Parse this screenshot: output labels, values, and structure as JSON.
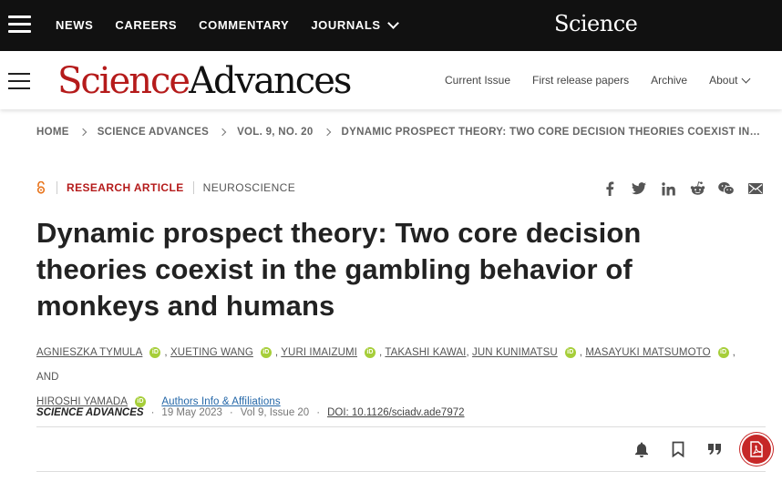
{
  "topnav": {
    "items": [
      {
        "label": "NEWS"
      },
      {
        "label": "CAREERS"
      },
      {
        "label": "COMMENTARY"
      },
      {
        "label": "JOURNALS"
      }
    ],
    "science_logo": "Science"
  },
  "brand": {
    "logo_science": "Science",
    "logo_advances": "Advances",
    "nav": [
      {
        "label": "Current Issue"
      },
      {
        "label": "First release papers"
      },
      {
        "label": "Archive"
      },
      {
        "label": "About"
      }
    ]
  },
  "breadcrumb": [
    "HOME",
    "SCIENCE ADVANCES",
    "VOL. 9, NO. 20",
    "DYNAMIC PROSPECT THEORY: TWO CORE DECISION THEORIES COEXIST IN THE GAMBLING BEHAVIOR OF MONKEYS AND HUMANS"
  ],
  "article": {
    "type": "RESEARCH ARTICLE",
    "subject": "NEUROSCIENCE",
    "title": "Dynamic prospect theory: Two core decision theories coexist in the gambling behavior of monkeys and humans",
    "authors": [
      {
        "name": "AGNIESZKA TYMULA",
        "orcid": true
      },
      {
        "name": "XUETING WANG",
        "orcid": true
      },
      {
        "name": "YURI IMAIZUMI",
        "orcid": true
      },
      {
        "name": "TAKASHI KAWAI",
        "orcid": false
      },
      {
        "name": "JUN KUNIMATSU",
        "orcid": true
      },
      {
        "name": "MASAYUKI MATSUMOTO",
        "orcid": true
      },
      {
        "name": "HIROSHI YAMADA",
        "orcid": true
      }
    ],
    "and_text": "AND",
    "affiliations_link": "Authors Info & Affiliations",
    "journal": "SCIENCE ADVANCES",
    "date": "19 May 2023",
    "issue": "Vol 9, Issue 20",
    "doi": "DOI: 10.1126/sciadv.ade7972"
  },
  "icons": {
    "share": [
      "facebook-icon",
      "twitter-icon",
      "linkedin-icon",
      "reddit-icon",
      "wechat-icon",
      "email-icon"
    ],
    "tools": [
      "alert-bell-icon",
      "bookmark-icon",
      "citation-icon",
      "pdf-icon"
    ],
    "orcid_color": "#a6ce39",
    "accent": "#b51b1b"
  }
}
